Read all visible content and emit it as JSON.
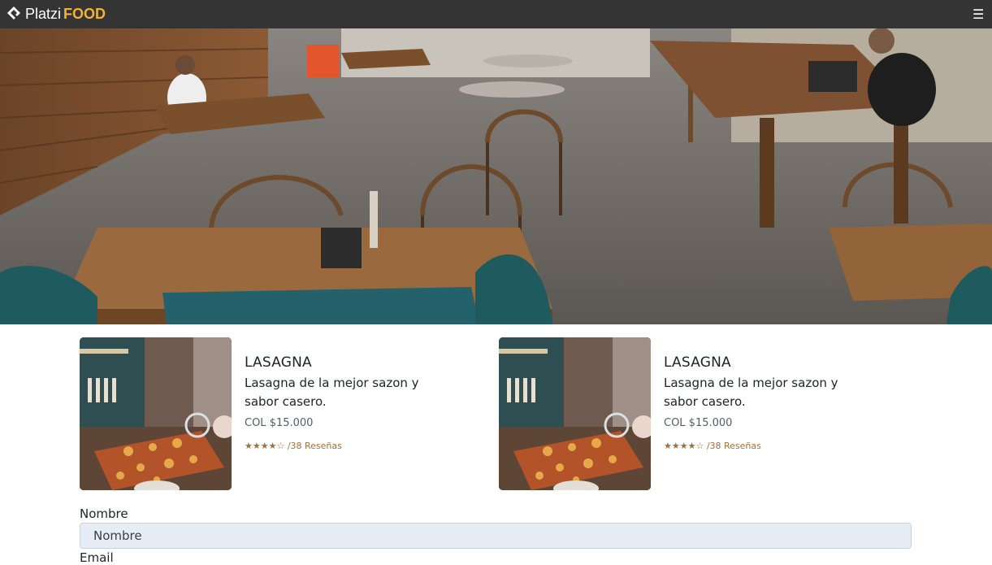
{
  "nav": {
    "brand_name": "Platzi",
    "brand_highlight": "FOOD",
    "menu_icon": "hamburger-icon",
    "brand_color": "#f2b233"
  },
  "hero": {
    "image": "restaurant-interior-photo"
  },
  "cards": [
    {
      "title": "LASAGNA",
      "description": "Lasagna de la mejor sazon y sabor casero.",
      "price": "COL $15.000",
      "rating_stars": "★★★★☆",
      "reviews": "/38 Reseñas",
      "image": "lasagna-photo"
    },
    {
      "title": "LASAGNA",
      "description": "Lasagna de la mejor sazon y sabor casero.",
      "price": "COL $15.000",
      "rating_stars": "★★★★☆",
      "reviews": "/38 Reseñas",
      "image": "lasagna-photo"
    }
  ],
  "form": {
    "name_label": "Nombre",
    "name_placeholder": "Nombre",
    "email_label": "Email"
  }
}
